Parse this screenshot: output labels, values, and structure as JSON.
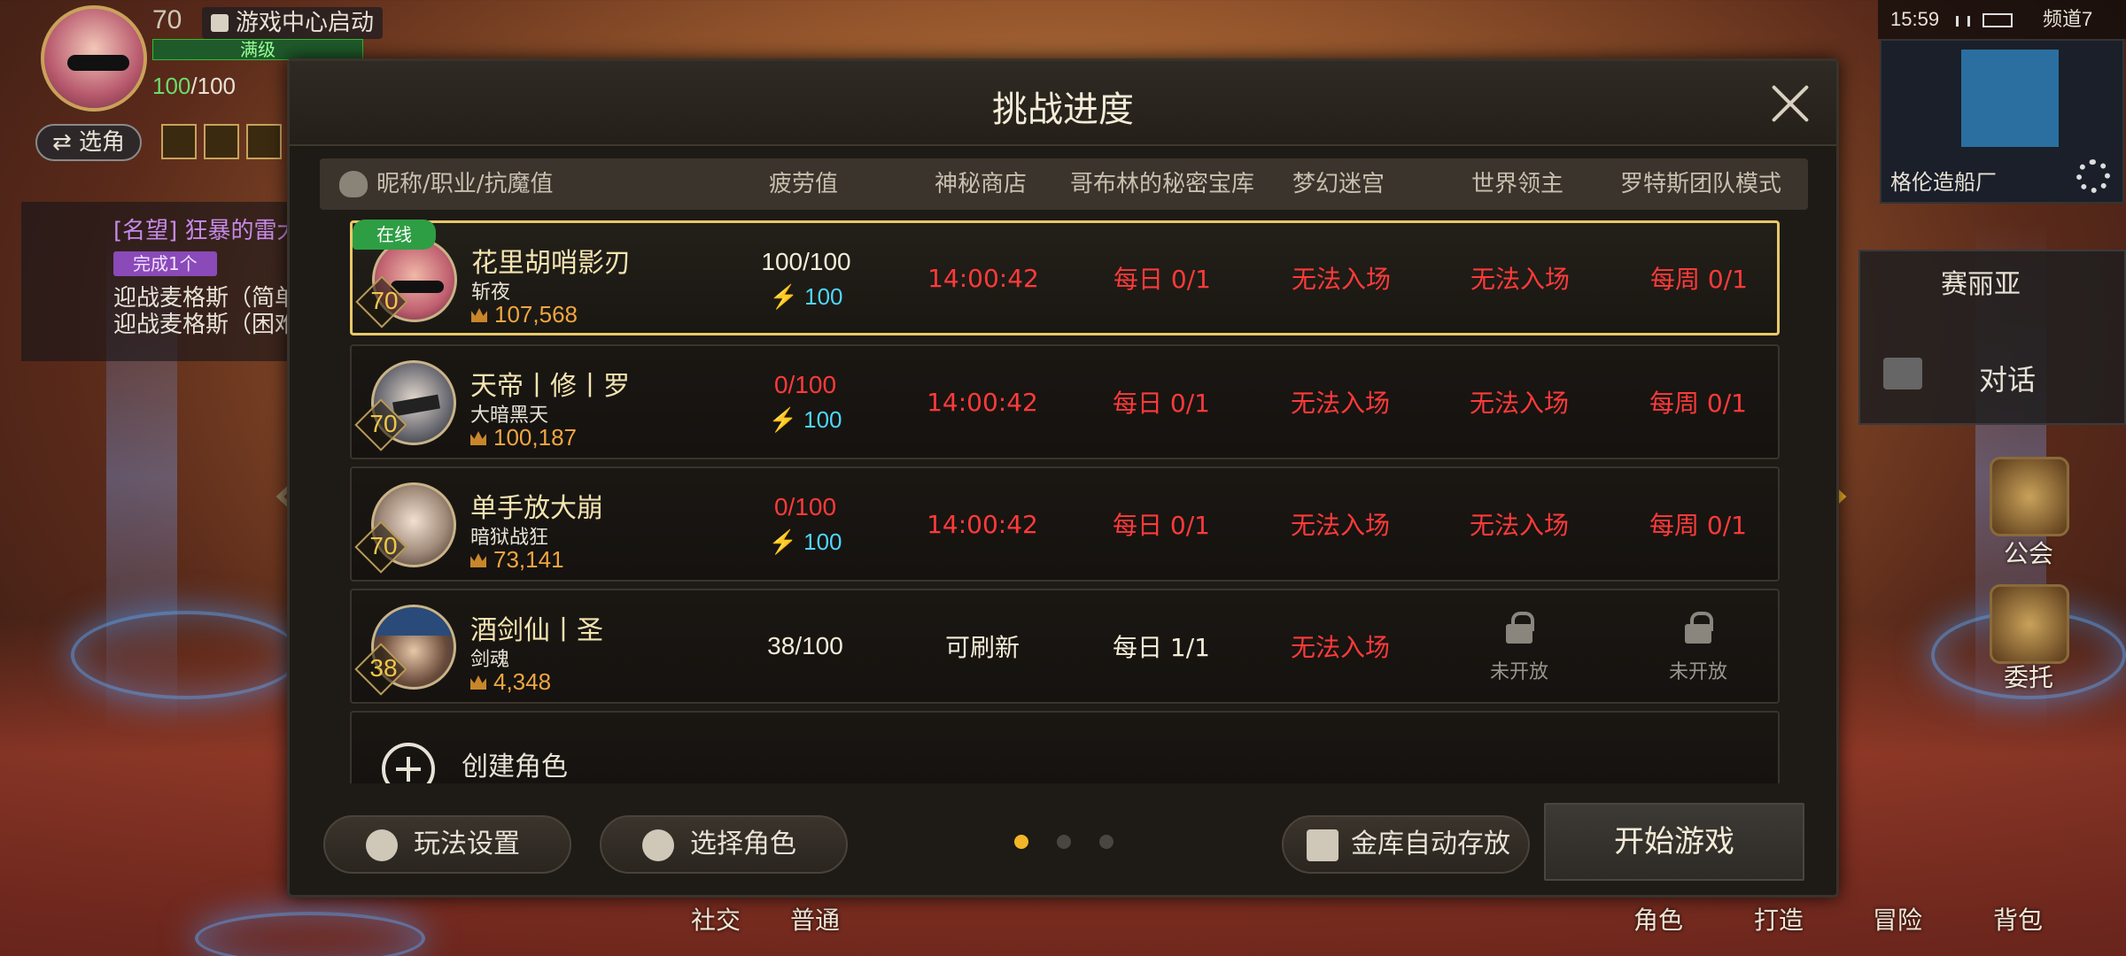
{
  "hud": {
    "level": "70",
    "game_center": "游戏中心启动",
    "max_level": "满级",
    "hp_current": "100",
    "hp_max": "/100",
    "switch_char": "⇄ 选角"
  },
  "quest": {
    "title": "[名望] 狂暴的雷大",
    "badge": "完成1个",
    "line1": "迎战麦格斯（简单",
    "line2": "迎战麦格斯（困难"
  },
  "status": {
    "time": "15:59",
    "channel": "频道7"
  },
  "minimap": {
    "name": "格伦造船厂"
  },
  "npc": {
    "name": "赛丽亚",
    "talk": "对话"
  },
  "side_menu": {
    "guild": "公会",
    "commission": "委托"
  },
  "bottom_nav": {
    "social": "社交",
    "normal": "普通",
    "character": "角色",
    "craft": "打造",
    "adventure": "冒险",
    "bag": "背包"
  },
  "modal": {
    "title": "挑战进度",
    "columns": {
      "name": "昵称/职业/抗魔值",
      "fatigue": "疲劳值",
      "shop": "神秘商店",
      "goblin": "哥布林的秘密宝库",
      "maze": "梦幻迷宫",
      "boss": "世界领主",
      "lotus": "罗特斯团队模式"
    },
    "online_label": "在线",
    "characters": [
      {
        "name": "花里胡哨影刃",
        "job": "斩夜",
        "power": "107,568",
        "level": "70",
        "fatigue": "100/100",
        "fatigue_bonus": "100",
        "shop": "14:00:42",
        "goblin": "每日 0/1",
        "maze": "无法入场",
        "boss": "无法入场",
        "lotus": "每周 0/1",
        "online": true
      },
      {
        "name": "天帝丨修丨罗",
        "job": "大暗黑天",
        "power": "100,187",
        "level": "70",
        "fatigue": "0/100",
        "fatigue_bonus": "100",
        "shop": "14:00:42",
        "goblin": "每日 0/1",
        "maze": "无法入场",
        "boss": "无法入场",
        "lotus": "每周 0/1"
      },
      {
        "name": "单手放大崩",
        "job": "暗狱战狂",
        "power": "73,141",
        "level": "70",
        "fatigue": "0/100",
        "fatigue_bonus": "100",
        "shop": "14:00:42",
        "goblin": "每日 0/1",
        "maze": "无法入场",
        "boss": "无法入场",
        "lotus": "每周 0/1"
      },
      {
        "name": "酒剑仙丨圣",
        "job": "剑魂",
        "power": "4,348",
        "level": "38",
        "fatigue": "38/100",
        "shop": "可刷新",
        "goblin": "每日 1/1",
        "maze": "无法入场",
        "boss": "未开放",
        "lotus": "未开放"
      }
    ],
    "create_label": "创建角色",
    "buttons": {
      "settings": "玩法设置",
      "select_char": "选择角色",
      "auto_store": "金库自动存放",
      "start": "开始游戏"
    },
    "page_dots": {
      "total": 3,
      "active": 0
    }
  },
  "colors": {
    "accent_gold": "#e8c868",
    "red_status": "#ff3a3a",
    "fatigue_blue": "#4fd6ff",
    "online_green": "#2e9e44",
    "active_dot": "#f2b628"
  }
}
